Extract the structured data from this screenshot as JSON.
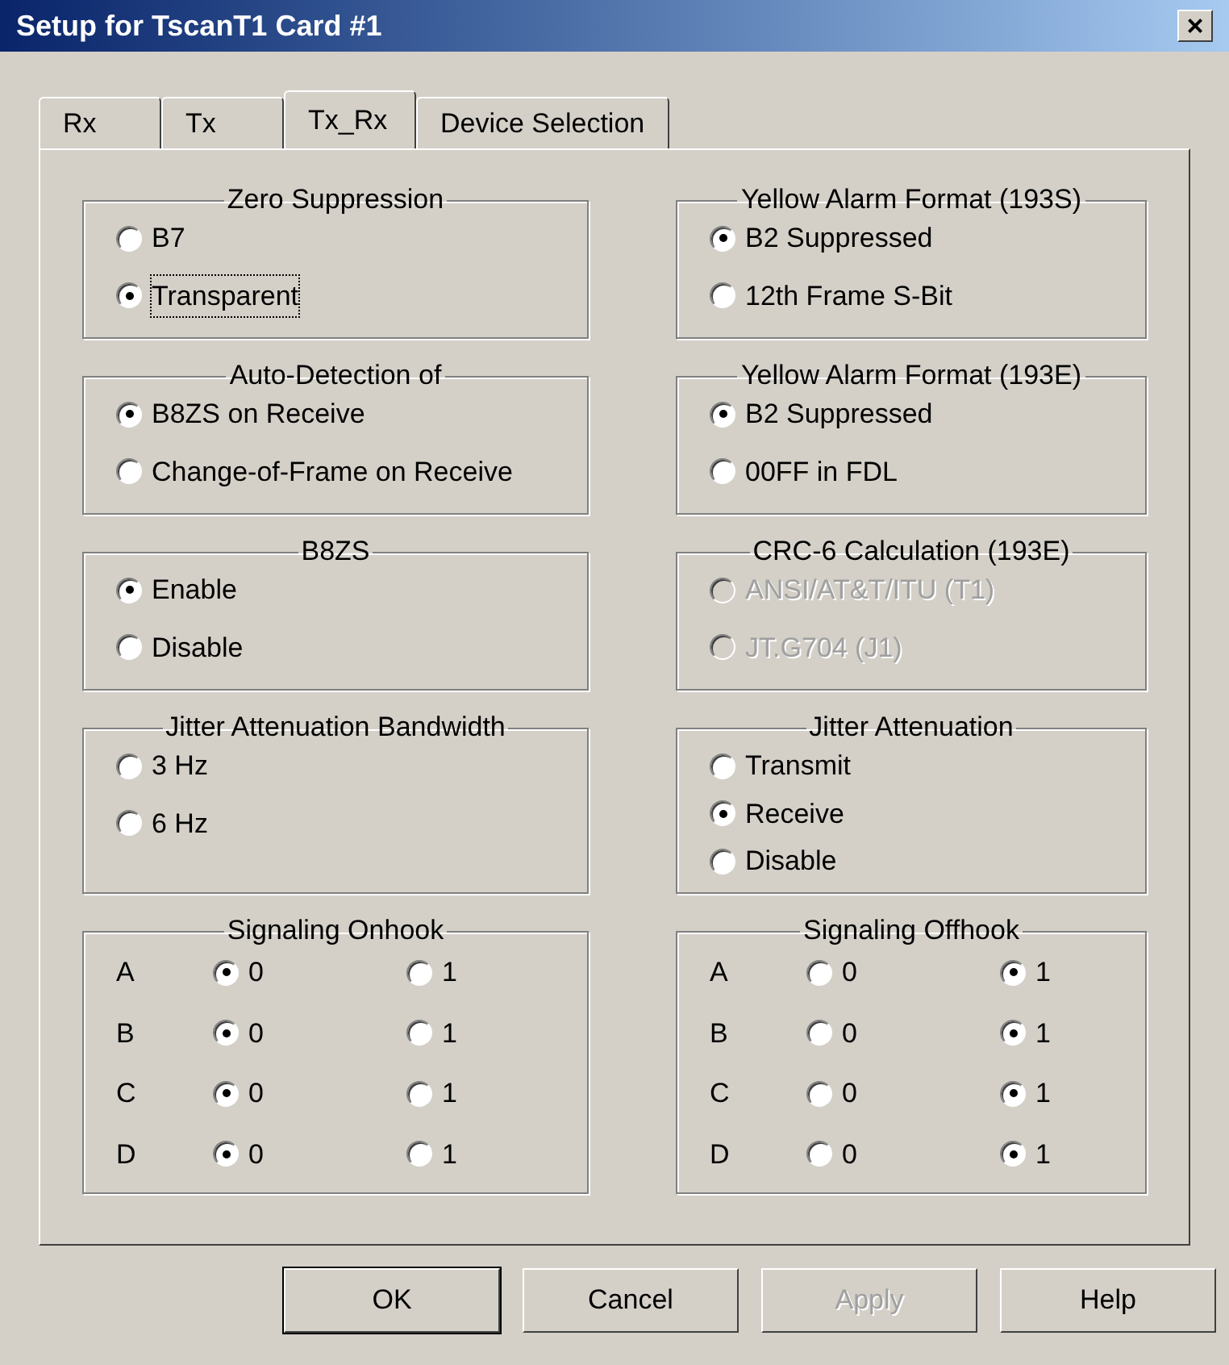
{
  "window": {
    "title": "Setup for TscanT1 Card #1",
    "close": "×"
  },
  "tabs": [
    {
      "label": "Rx",
      "selected": false
    },
    {
      "label": "Tx",
      "selected": false
    },
    {
      "label": "Tx_Rx",
      "selected": true
    },
    {
      "label": "Device Selection",
      "selected": false
    }
  ],
  "left_groups": [
    {
      "kind": "radio",
      "title": "Zero Suppression",
      "options": [
        {
          "label": "B7",
          "selected": false,
          "disabled": false,
          "focused": false
        },
        {
          "label": "Transparent",
          "selected": true,
          "disabled": false,
          "focused": true
        }
      ]
    },
    {
      "kind": "radio",
      "title": "Auto-Detection of",
      "options": [
        {
          "label": "B8ZS on Receive",
          "selected": true,
          "disabled": false
        },
        {
          "label": "Change-of-Frame on Receive",
          "selected": false,
          "disabled": false
        }
      ]
    },
    {
      "kind": "radio",
      "title": "B8ZS",
      "options": [
        {
          "label": "Enable",
          "selected": true,
          "disabled": false
        },
        {
          "label": "Disable",
          "selected": false,
          "disabled": false
        }
      ]
    },
    {
      "kind": "radio",
      "title": "Jitter Attenuation Bandwidth",
      "options": [
        {
          "label": "3 Hz",
          "selected": false,
          "disabled": false
        },
        {
          "label": "6 Hz",
          "selected": false,
          "disabled": false
        }
      ]
    },
    {
      "kind": "grid",
      "title": "Signaling Onhook",
      "rows": [
        {
          "label": "A",
          "options": [
            {
              "label": "0",
              "selected": true
            },
            {
              "label": "1",
              "selected": false
            }
          ]
        },
        {
          "label": "B",
          "options": [
            {
              "label": "0",
              "selected": true
            },
            {
              "label": "1",
              "selected": false
            }
          ]
        },
        {
          "label": "C",
          "options": [
            {
              "label": "0",
              "selected": true
            },
            {
              "label": "1",
              "selected": false
            }
          ]
        },
        {
          "label": "D",
          "options": [
            {
              "label": "0",
              "selected": true
            },
            {
              "label": "1",
              "selected": false
            }
          ]
        }
      ]
    }
  ],
  "right_groups": [
    {
      "kind": "radio",
      "title": "Yellow Alarm Format (193S)",
      "options": [
        {
          "label": "B2 Suppressed",
          "selected": true,
          "disabled": false
        },
        {
          "label": "12th Frame S-Bit",
          "selected": false,
          "disabled": false
        }
      ]
    },
    {
      "kind": "radio",
      "title": "Yellow Alarm Format (193E)",
      "options": [
        {
          "label": "B2 Suppressed",
          "selected": true,
          "disabled": false
        },
        {
          "label": "00FF in FDL",
          "selected": false,
          "disabled": false
        }
      ]
    },
    {
      "kind": "radio",
      "title": "CRC-6 Calculation (193E)",
      "options": [
        {
          "label": "ANSI/AT&T/ITU (T1)",
          "selected": false,
          "disabled": true
        },
        {
          "label": "JT.G704 (J1)",
          "selected": false,
          "disabled": true
        }
      ]
    },
    {
      "kind": "radio",
      "title": "Jitter Attenuation",
      "options": [
        {
          "label": "Transmit",
          "selected": false,
          "disabled": false
        },
        {
          "label": "Receive",
          "selected": true,
          "disabled": false
        },
        {
          "label": "Disable",
          "selected": false,
          "disabled": false
        }
      ]
    },
    {
      "kind": "grid",
      "title": "Signaling Offhook",
      "rows": [
        {
          "label": "A",
          "options": [
            {
              "label": "0",
              "selected": false
            },
            {
              "label": "1",
              "selected": true
            }
          ]
        },
        {
          "label": "B",
          "options": [
            {
              "label": "0",
              "selected": false
            },
            {
              "label": "1",
              "selected": true
            }
          ]
        },
        {
          "label": "C",
          "options": [
            {
              "label": "0",
              "selected": false
            },
            {
              "label": "1",
              "selected": true
            }
          ]
        },
        {
          "label": "D",
          "options": [
            {
              "label": "0",
              "selected": false
            },
            {
              "label": "1",
              "selected": true
            }
          ]
        }
      ]
    }
  ],
  "buttons": [
    {
      "label": "OK",
      "default": true,
      "disabled": false
    },
    {
      "label": "Cancel",
      "default": false,
      "disabled": false
    },
    {
      "label": "Apply",
      "default": false,
      "disabled": true
    },
    {
      "label": "Help",
      "default": false,
      "disabled": false
    }
  ]
}
